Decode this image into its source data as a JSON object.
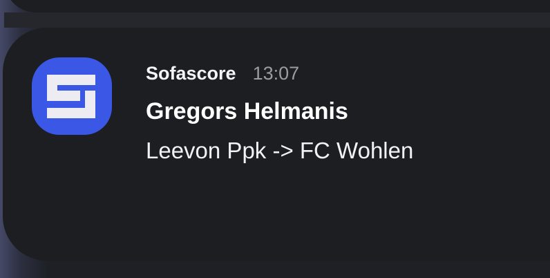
{
  "notification": {
    "app_name": "Sofascore",
    "time": "13:07",
    "title": "Gregors Helmanis",
    "body": "Leevon Ppk -> FC Wohlen",
    "icon": "sofascore-logo-icon",
    "accent_color": "#3b57e6"
  }
}
